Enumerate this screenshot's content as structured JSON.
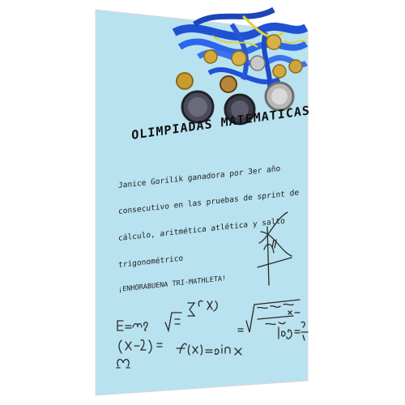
{
  "card": {
    "title": "OLIMPIADAS MATEMATICAS",
    "lines": [
      "Janice Gorilik ganadora por 3er año",
      "consecutivo en las pruebas de sprint de",
      "cálculo, aritmética atlética y salto",
      "trigonométrico",
      "¡ENHORABUENA TRI-MATHLETA!"
    ],
    "background_color": "#b8e2ef",
    "ribbon_color": "#2b5fd6"
  }
}
